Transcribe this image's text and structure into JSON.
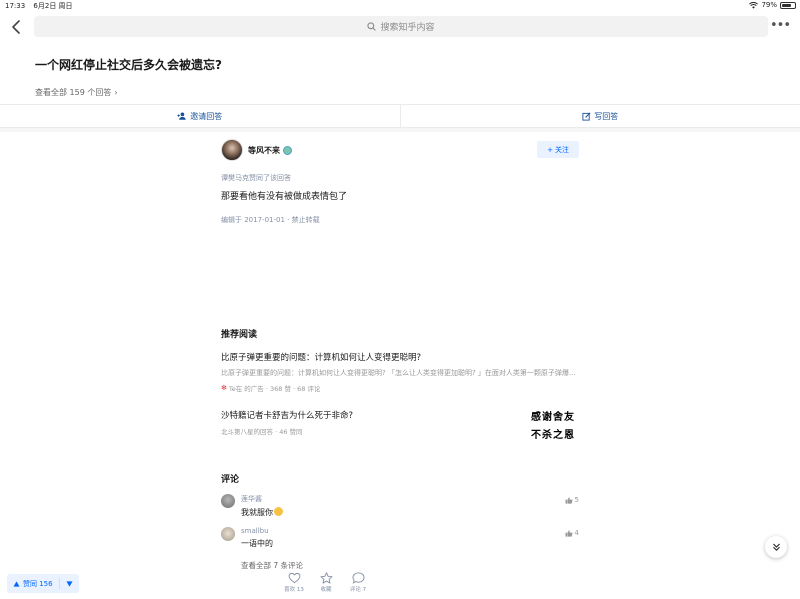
{
  "status_bar": {
    "time": "17:33",
    "date": "6月2日 周日",
    "battery_text": "79%",
    "battery_level": 0.79
  },
  "topbar": {
    "search_placeholder": "搜索知乎内容"
  },
  "question": {
    "title": "一个网红停止社交后多久会被遗忘?",
    "view_all": "查看全部 159 个回答"
  },
  "actions": {
    "invite": "邀请回答",
    "write": "写回答"
  },
  "answer": {
    "author": "等风不来",
    "follow_label": "关注",
    "upvoted_by": "谭樊马克赞同了该回答",
    "body": "那要看他有没有被做成表情包了",
    "meta": "编辑于 2017-01-01 · 禁止转载"
  },
  "recommend": {
    "section_title": "推荐阅读",
    "items": [
      {
        "title": "比原子弹更重要的问题：计算机如何让人变得更聪明?",
        "excerpt": "比原子弹更重要的问题：计算机如何让人变得更聪明? 「怎么让人类变得更加聪明? 」在面对人类第一颗原子弹爆...",
        "meta": "Te在 的广告 · 368 赞 · 68 评论"
      },
      {
        "title": "沙特籍记者卡舒吉为什么死于非命?",
        "meta": "北斗第八星的回答 · 46 赞同",
        "thumb_line1": "感谢舍友",
        "thumb_line2": "不杀之恩"
      }
    ]
  },
  "comments": {
    "section_title": "评论",
    "items": [
      {
        "user": "莲华酱",
        "text": "我就服你",
        "likes": "5"
      },
      {
        "user": "smallbu",
        "text": "一语中的",
        "likes": "4"
      }
    ],
    "view_all": "查看全部 7 条评论"
  },
  "bottom_bar": {
    "vote_label": "赞同 156",
    "thanks_label": "喜欢 13",
    "collect_label": "收藏",
    "comment_label": "评论 7"
  },
  "colors": {
    "brand_blue": "#0066ff",
    "link_blue": "#175199",
    "meta_gray": "#8590a6"
  },
  "icons": {
    "back": "chevron-left-icon",
    "search": "search-icon",
    "more": "more-dots-icon",
    "invite": "add-user-icon",
    "write": "pencil-icon",
    "like": "thumbs-up-icon",
    "heart": "heart-icon",
    "star": "star-icon",
    "comment": "comment-bubble-icon",
    "scroll_down": "double-chevron-down-icon"
  }
}
